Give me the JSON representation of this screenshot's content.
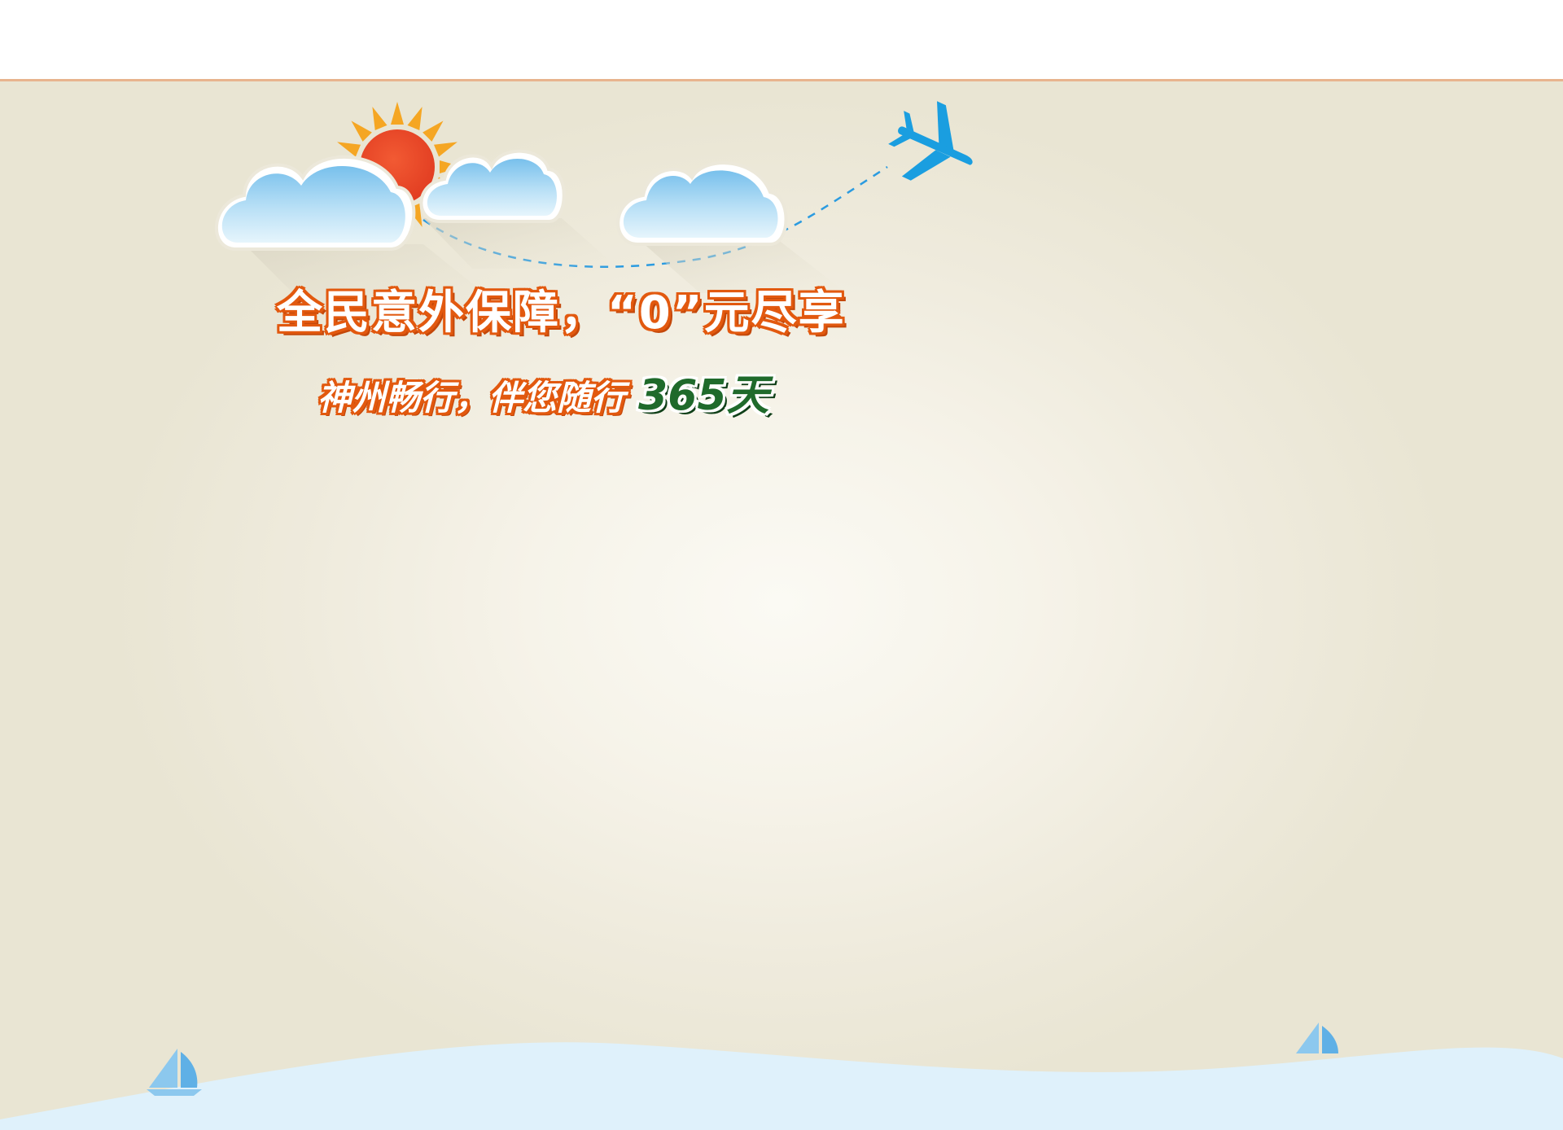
{
  "hero": {
    "headline": "全民意外保障，“0”元尽享",
    "subline": "神州畅行，伴您随行",
    "days": "365天"
  },
  "colors": {
    "accent_orange": "#e2590f",
    "sun_red": "#ee4a2a",
    "sun_ray": "#f5a623",
    "cloud_blue": "#8fcdf0",
    "plane_blue": "#1a9ee0",
    "days_green": "#1f6a2b",
    "sea_blue": "#dff1fb"
  },
  "icons": [
    "sun-icon",
    "cloud-icon",
    "airplane-icon",
    "sailboat-icon"
  ]
}
